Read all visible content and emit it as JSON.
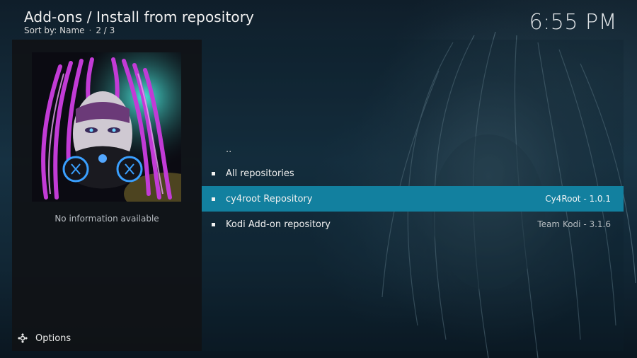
{
  "header": {
    "title": "Add-ons / Install from repository",
    "sort_label": "Sort by: Name",
    "separator": "·",
    "page_count": "2 / 3",
    "clock": "6:55 PM"
  },
  "info_panel": {
    "thumbnail_icon": "cyberpunk-portrait-artwork",
    "message": "No information available"
  },
  "list": {
    "parent": "..",
    "items": [
      {
        "label": "All repositories",
        "right": "",
        "selected": false
      },
      {
        "label": "cy4root Repository",
        "right": "Cy4Root - 1.0.1",
        "selected": true
      },
      {
        "label": "Kodi Add-on repository",
        "right": "Team Kodi - 3.1.6",
        "selected": false
      }
    ]
  },
  "footer": {
    "options_label": "Options",
    "options_icon": "gear-icon"
  },
  "colors": {
    "selection": "#12809f",
    "side_panel": "#101216",
    "text": "#f0f0f0",
    "muted_text": "#b8bec2"
  }
}
